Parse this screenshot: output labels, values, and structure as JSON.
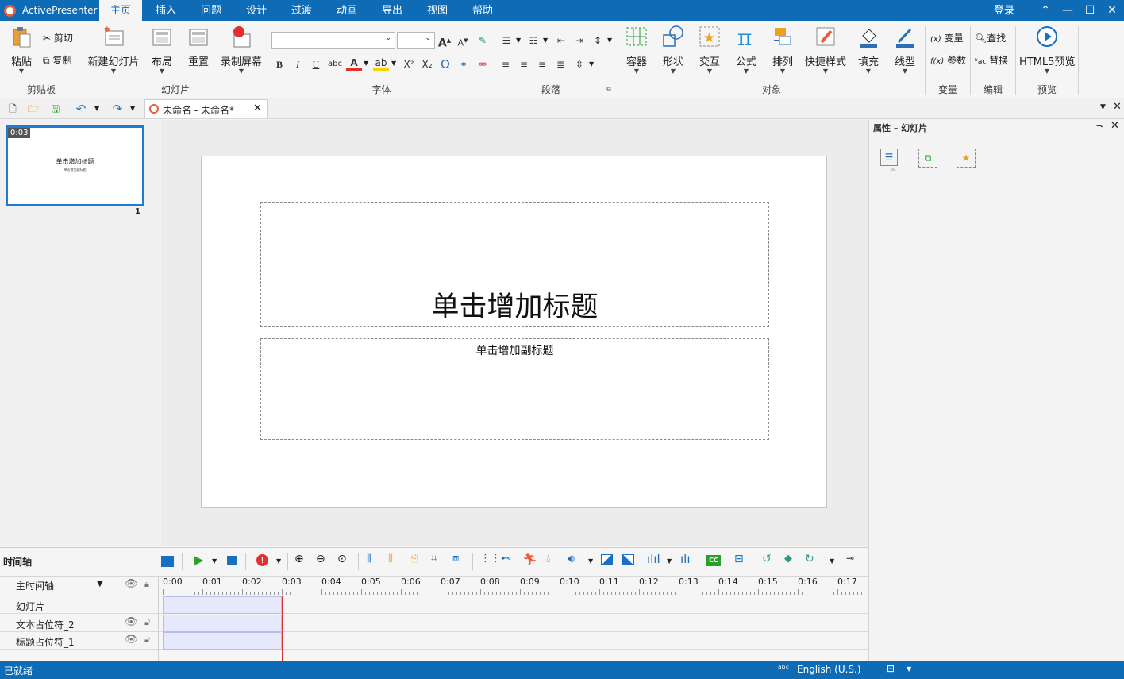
{
  "app": {
    "name": "ActivePresenter",
    "login": "登录",
    "brand_color": "#0e6bb6",
    "accent_red": "#e03030"
  },
  "tabs": [
    {
      "label": "主页"
    },
    {
      "label": "插入"
    },
    {
      "label": "问题"
    },
    {
      "label": "设计"
    },
    {
      "label": "过渡"
    },
    {
      "label": "动画"
    },
    {
      "label": "导出"
    },
    {
      "label": "视图"
    },
    {
      "label": "帮助"
    }
  ],
  "ribbon": {
    "clipboard": {
      "paste": "粘贴",
      "cut": "剪切",
      "copy": "复制",
      "group": "剪贴板"
    },
    "slides": {
      "new_slide": "新建幻灯片",
      "layout": "布局",
      "reset": "重置",
      "record": "录制屏幕",
      "group": "幻灯片"
    },
    "font": {
      "group": "字体",
      "bold": "B",
      "italic": "I",
      "underline": "U",
      "strike": "abc",
      "superscript": "X²",
      "subscript": "X₂",
      "omega": "Ω"
    },
    "paragraph": {
      "group": "段落"
    },
    "objects": {
      "container": "容器",
      "shape": "形状",
      "interaction": "交互",
      "formula": "公式",
      "arrange": "排列",
      "quick_style": "快捷样式",
      "fill": "填充",
      "line": "线型",
      "group": "对象"
    },
    "variables": {
      "variable": "变量",
      "param": "参数",
      "group": "变量"
    },
    "edit": {
      "find": "查找",
      "replace": "替换",
      "group": "编辑"
    },
    "preview": {
      "html5": "HTML5预览",
      "group": "预览"
    }
  },
  "document": {
    "tab_title": "未命名 - 未命名*"
  },
  "thumbnail": {
    "duration": "0:03",
    "title": "单击增加标题",
    "subtitle": "单击增加副标题",
    "number": "1"
  },
  "slide": {
    "title_placeholder": "单击增加标题",
    "subtitle_placeholder": "单击增加副标题"
  },
  "properties": {
    "title": "属性 – 幻灯片"
  },
  "timeline": {
    "title": "时间轴",
    "main_timeline": "主时间轴",
    "ticks": [
      "0:00",
      "0:01",
      "0:02",
      "0:03",
      "0:04",
      "0:05",
      "0:06",
      "0:07",
      "0:08",
      "0:09",
      "0:10",
      "0:11",
      "0:12",
      "0:13",
      "0:14",
      "0:15",
      "0:16",
      "0:17"
    ],
    "rows": [
      {
        "label": "幻灯片"
      },
      {
        "label": "文本占位符_2"
      },
      {
        "label": "标题占位符_1"
      }
    ],
    "cc": "CC"
  },
  "status": {
    "text": "已就绪",
    "language": "English (U.S.)"
  }
}
